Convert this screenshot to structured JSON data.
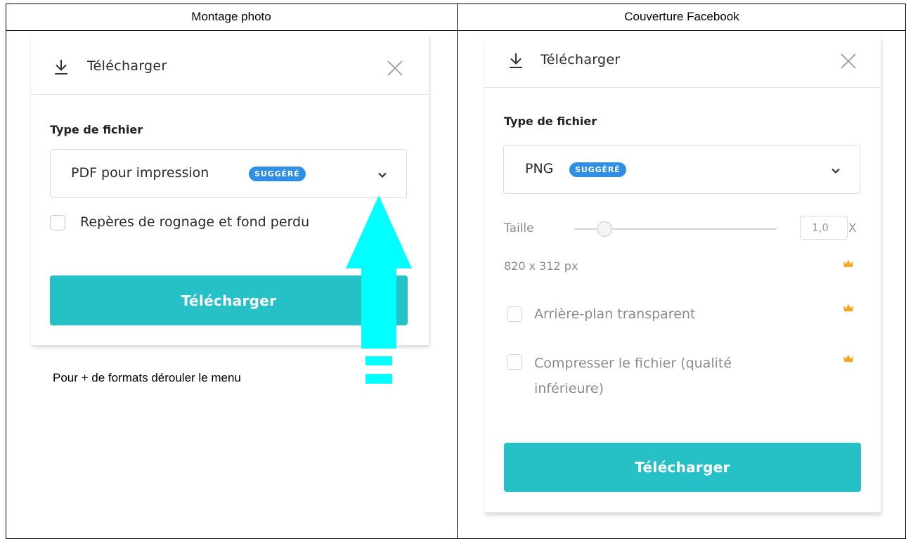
{
  "columns": {
    "left_header": "Montage photo",
    "right_header": "Couverture Facebook"
  },
  "left_panel": {
    "title": "Télécharger",
    "file_type_label": "Type de fichier",
    "file_type_value": "PDF pour impression",
    "badge": "SUGGÉRÉ",
    "crop_marks_label": "Repères de rognage et fond perdu",
    "download_button": "Télécharger"
  },
  "note": "Pour + de formats dérouler le menu",
  "right_panel": {
    "title": "Télécharger",
    "file_type_label": "Type de fichier",
    "file_type_value": "PNG",
    "badge": "SUGGÉRÉ",
    "size_label": "Taille",
    "size_value": "1,0",
    "size_unit": "X",
    "size_slider_level": 0.12,
    "dimensions": "820 x 312 px",
    "transparent_label": "Arrière-plan transparent",
    "compress_label_line1": "Compresser le fichier (qualité",
    "compress_label_line2": "inférieure)",
    "download_button": "Télécharger"
  },
  "colors": {
    "accent": "#26c0c7",
    "badge": "#2f8fe6",
    "annotation_arrow": "#00ffff",
    "crown": "#f2a921"
  },
  "icons": [
    "download-icon",
    "close-icon",
    "chevron-down-icon",
    "crown-icon",
    "arrow-up-icon"
  ]
}
